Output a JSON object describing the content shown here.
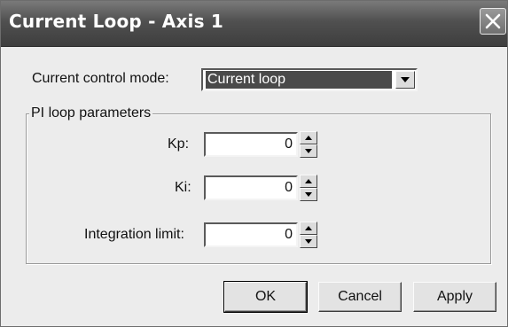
{
  "window": {
    "title": "Current Loop - Axis 1"
  },
  "control_mode": {
    "label": "Current control mode:",
    "selected": "Current loop"
  },
  "pi_group": {
    "legend": "PI loop parameters",
    "fields": [
      {
        "label": "Kp:",
        "value": "0"
      },
      {
        "label": "Ki:",
        "value": "0"
      },
      {
        "label": "Integration limit:",
        "value": "0"
      }
    ]
  },
  "buttons": {
    "ok": "OK",
    "cancel": "Cancel",
    "apply": "Apply"
  },
  "icons": {
    "close": "close-icon",
    "dropdown": "chevron-down-icon",
    "spin_up": "arrow-up-icon",
    "spin_down": "arrow-down-icon"
  },
  "colors": {
    "titlebar": "#505050",
    "selection": "#4a4a4a",
    "dialog_bg": "#ececec"
  }
}
